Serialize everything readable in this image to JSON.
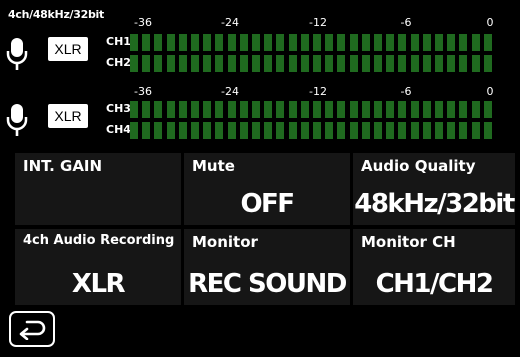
{
  "header": {
    "format": "4ch/48kHz/32bit"
  },
  "meter_groups": [
    {
      "input": "XLR",
      "scale": [
        "-36",
        "-24",
        "-12",
        "-6",
        "0"
      ],
      "channels": [
        "CH1",
        "CH2"
      ]
    },
    {
      "input": "XLR",
      "scale": [
        "-36",
        "-24",
        "-12",
        "-6",
        "0"
      ],
      "channels": [
        "CH3",
        "CH4"
      ]
    }
  ],
  "settings": {
    "int_gain": {
      "title": "INT. GAIN",
      "value": ""
    },
    "mute": {
      "title": "Mute",
      "value": "OFF"
    },
    "audio_quality": {
      "title": "Audio Quality",
      "value": "48kHz/32bit"
    },
    "recording_4ch": {
      "title": "4ch Audio Recording",
      "value": "XLR"
    },
    "monitor": {
      "title": "Monitor",
      "value": "REC SOUND"
    },
    "monitor_ch": {
      "title": "Monitor CH",
      "value": "CH1/CH2"
    }
  },
  "colors": {
    "meter_segment": "#1f6a1f",
    "cell_bg": "#161616"
  },
  "icons": {
    "mic": "microphone-icon",
    "back": "back-arrow-icon"
  }
}
